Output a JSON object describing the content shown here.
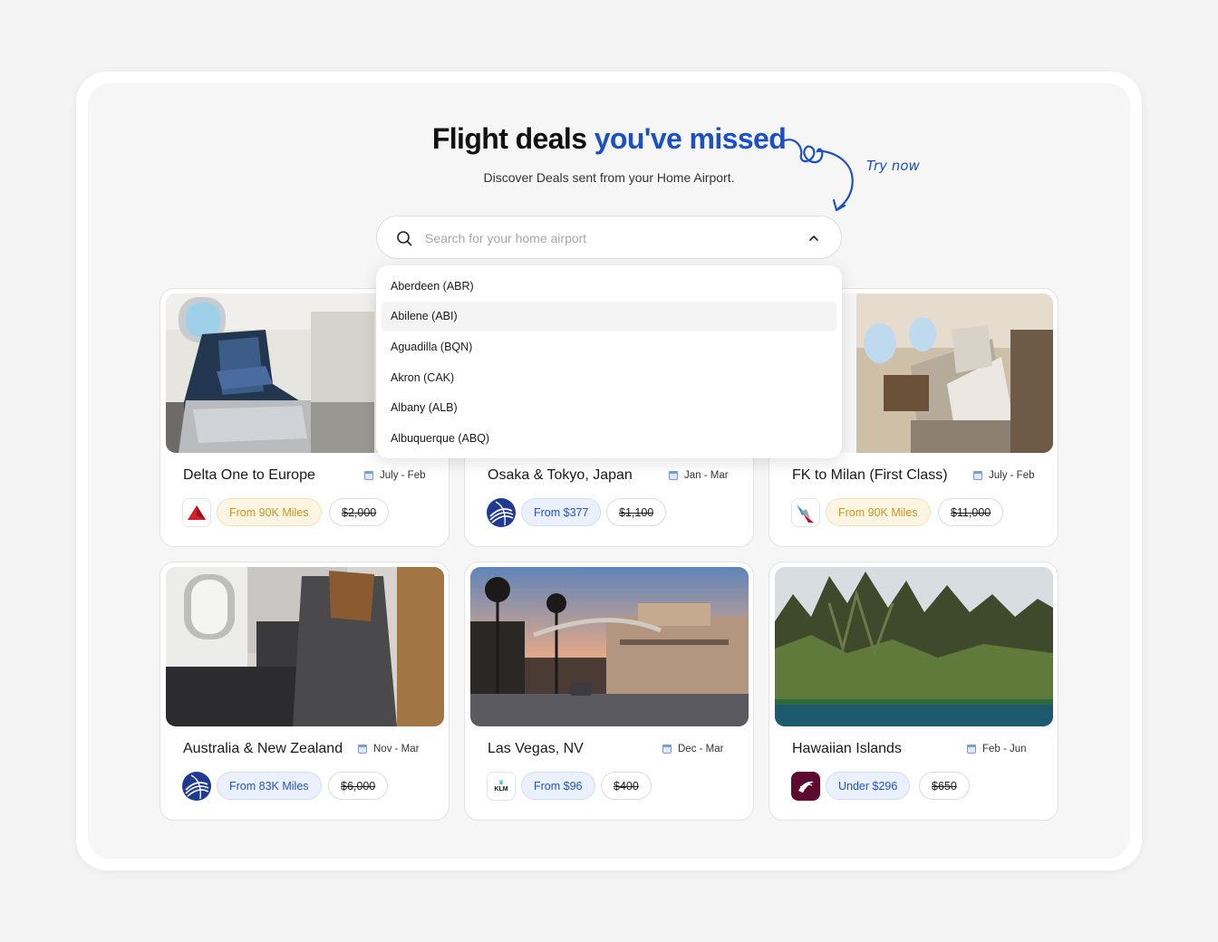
{
  "header": {
    "title_main": "Flight deals",
    "title_accent": "you've missed",
    "subtitle": "Discover Deals sent from your Home Airport.",
    "annotation": "Try now"
  },
  "search": {
    "placeholder": "Search for your home airport",
    "value": "",
    "options": [
      "Aberdeen (ABR)",
      "Abilene (ABI)",
      "Aguadilla (BQN)",
      "Akron (CAK)",
      "Albany (ALB)",
      "Albuquerque (ABQ)"
    ],
    "highlighted": "Abilene (ABI)"
  },
  "cards": [
    {
      "title": "Delta One to Europe",
      "dates": "July - Feb",
      "price": "From 90K Miles",
      "was": "$2,000",
      "airline_icon": "delta-logo",
      "scene": "delta-cabin-seat",
      "price_style": "gold"
    },
    {
      "title": "Osaka & Tokyo, Japan",
      "dates": "Jan - Mar",
      "price": "From $377",
      "was": "$1,100",
      "airline_icon": "united-globe-logo",
      "scene": "japan",
      "price_style": "blue"
    },
    {
      "title": "FK to Milan (First Class)",
      "dates": "July - Feb",
      "price": "From 90K Miles",
      "was": "$11,000",
      "airline_icon": "american-airlines-logo",
      "scene": "first-class-cabin",
      "price_style": "gold"
    },
    {
      "title": "Australia & New Zealand",
      "dates": "Nov - Mar",
      "price": "From 83K Miles",
      "was": "$6,000",
      "airline_icon": "united-globe-logo",
      "scene": "business-seat",
      "price_style": "blue"
    },
    {
      "title": "Las Vegas, NV",
      "dates": "Dec - Mar",
      "price": "From $96",
      "was": "$400",
      "airline_icon": "klm-logo",
      "scene": "las-vegas-street",
      "price_style": "blue",
      "logo_text": "KLM"
    },
    {
      "title": "Hawaiian Islands",
      "dates": "Feb - Jun",
      "price": "Under $296",
      "was": "$650",
      "airline_icon": "qatar-logo",
      "scene": "hawaii-cliffs",
      "price_style": "blue"
    }
  ],
  "colors": {
    "accent": "#1d4fc4",
    "gold_text": "#c9961e",
    "blue_text": "#2452c2",
    "panel_bg": "#f6f6f6"
  }
}
